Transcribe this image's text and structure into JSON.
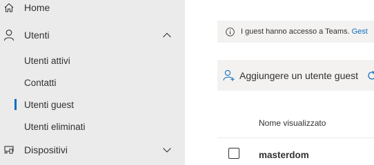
{
  "sidebar": {
    "home_label": "Home",
    "users_label": "Utenti",
    "sub_items": [
      {
        "label": "Utenti attivi"
      },
      {
        "label": "Contatti"
      },
      {
        "label": "Utenti guest"
      },
      {
        "label": "Utenti eliminati"
      }
    ],
    "devices_label": "Dispositivi",
    "active_accent": "#0f6cbd"
  },
  "message_bar": {
    "text": "I guest hanno accesso a Teams.",
    "link": "Gest"
  },
  "command_bar": {
    "add_guest_label": "Aggiungere un utente guest"
  },
  "table": {
    "column_header": "Nome visualizzato",
    "rows": [
      {
        "name": "masterdom"
      }
    ]
  },
  "icons": {
    "home": "home-icon",
    "users": "person-icon",
    "devices": "devices-icon",
    "info": "info-icon",
    "add_person": "add-person-icon",
    "refresh": "refresh-icon"
  }
}
